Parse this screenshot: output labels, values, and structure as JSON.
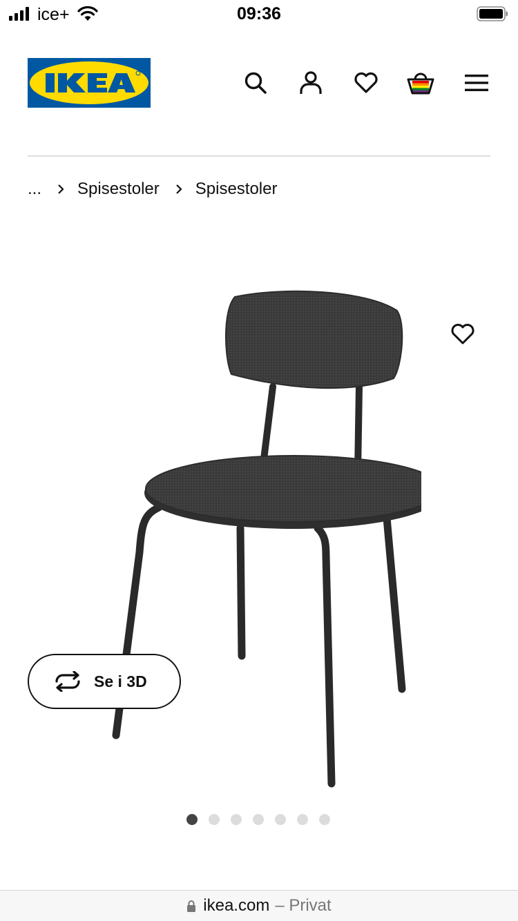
{
  "status_bar": {
    "carrier": "ice+",
    "time": "09:36",
    "signal_icon": "signal-bars-icon",
    "wifi_icon": "wifi-icon",
    "battery_icon": "battery-icon"
  },
  "header": {
    "logo_text": "IKEA",
    "brand_colors": {
      "blue": "#0058A3",
      "yellow": "#FFDB00"
    },
    "icons": [
      "search-icon",
      "account-icon",
      "heart-icon",
      "shopping-basket-icon",
      "hamburger-menu-icon"
    ]
  },
  "breadcrumb": {
    "ellipsis": "...",
    "items": [
      "Spisestoler",
      "Spisestoler"
    ]
  },
  "product": {
    "image_subject": "chair-image",
    "favorite_icon": "heart-outline-icon",
    "view_3d_label": "Se i 3D",
    "view_3d_icon": "rotate-3d-icon"
  },
  "carousel": {
    "total": 7,
    "active_index": 1
  },
  "address_bar": {
    "domain": "ikea.com",
    "mode": "– Privat",
    "lock_icon": "lock-icon"
  }
}
